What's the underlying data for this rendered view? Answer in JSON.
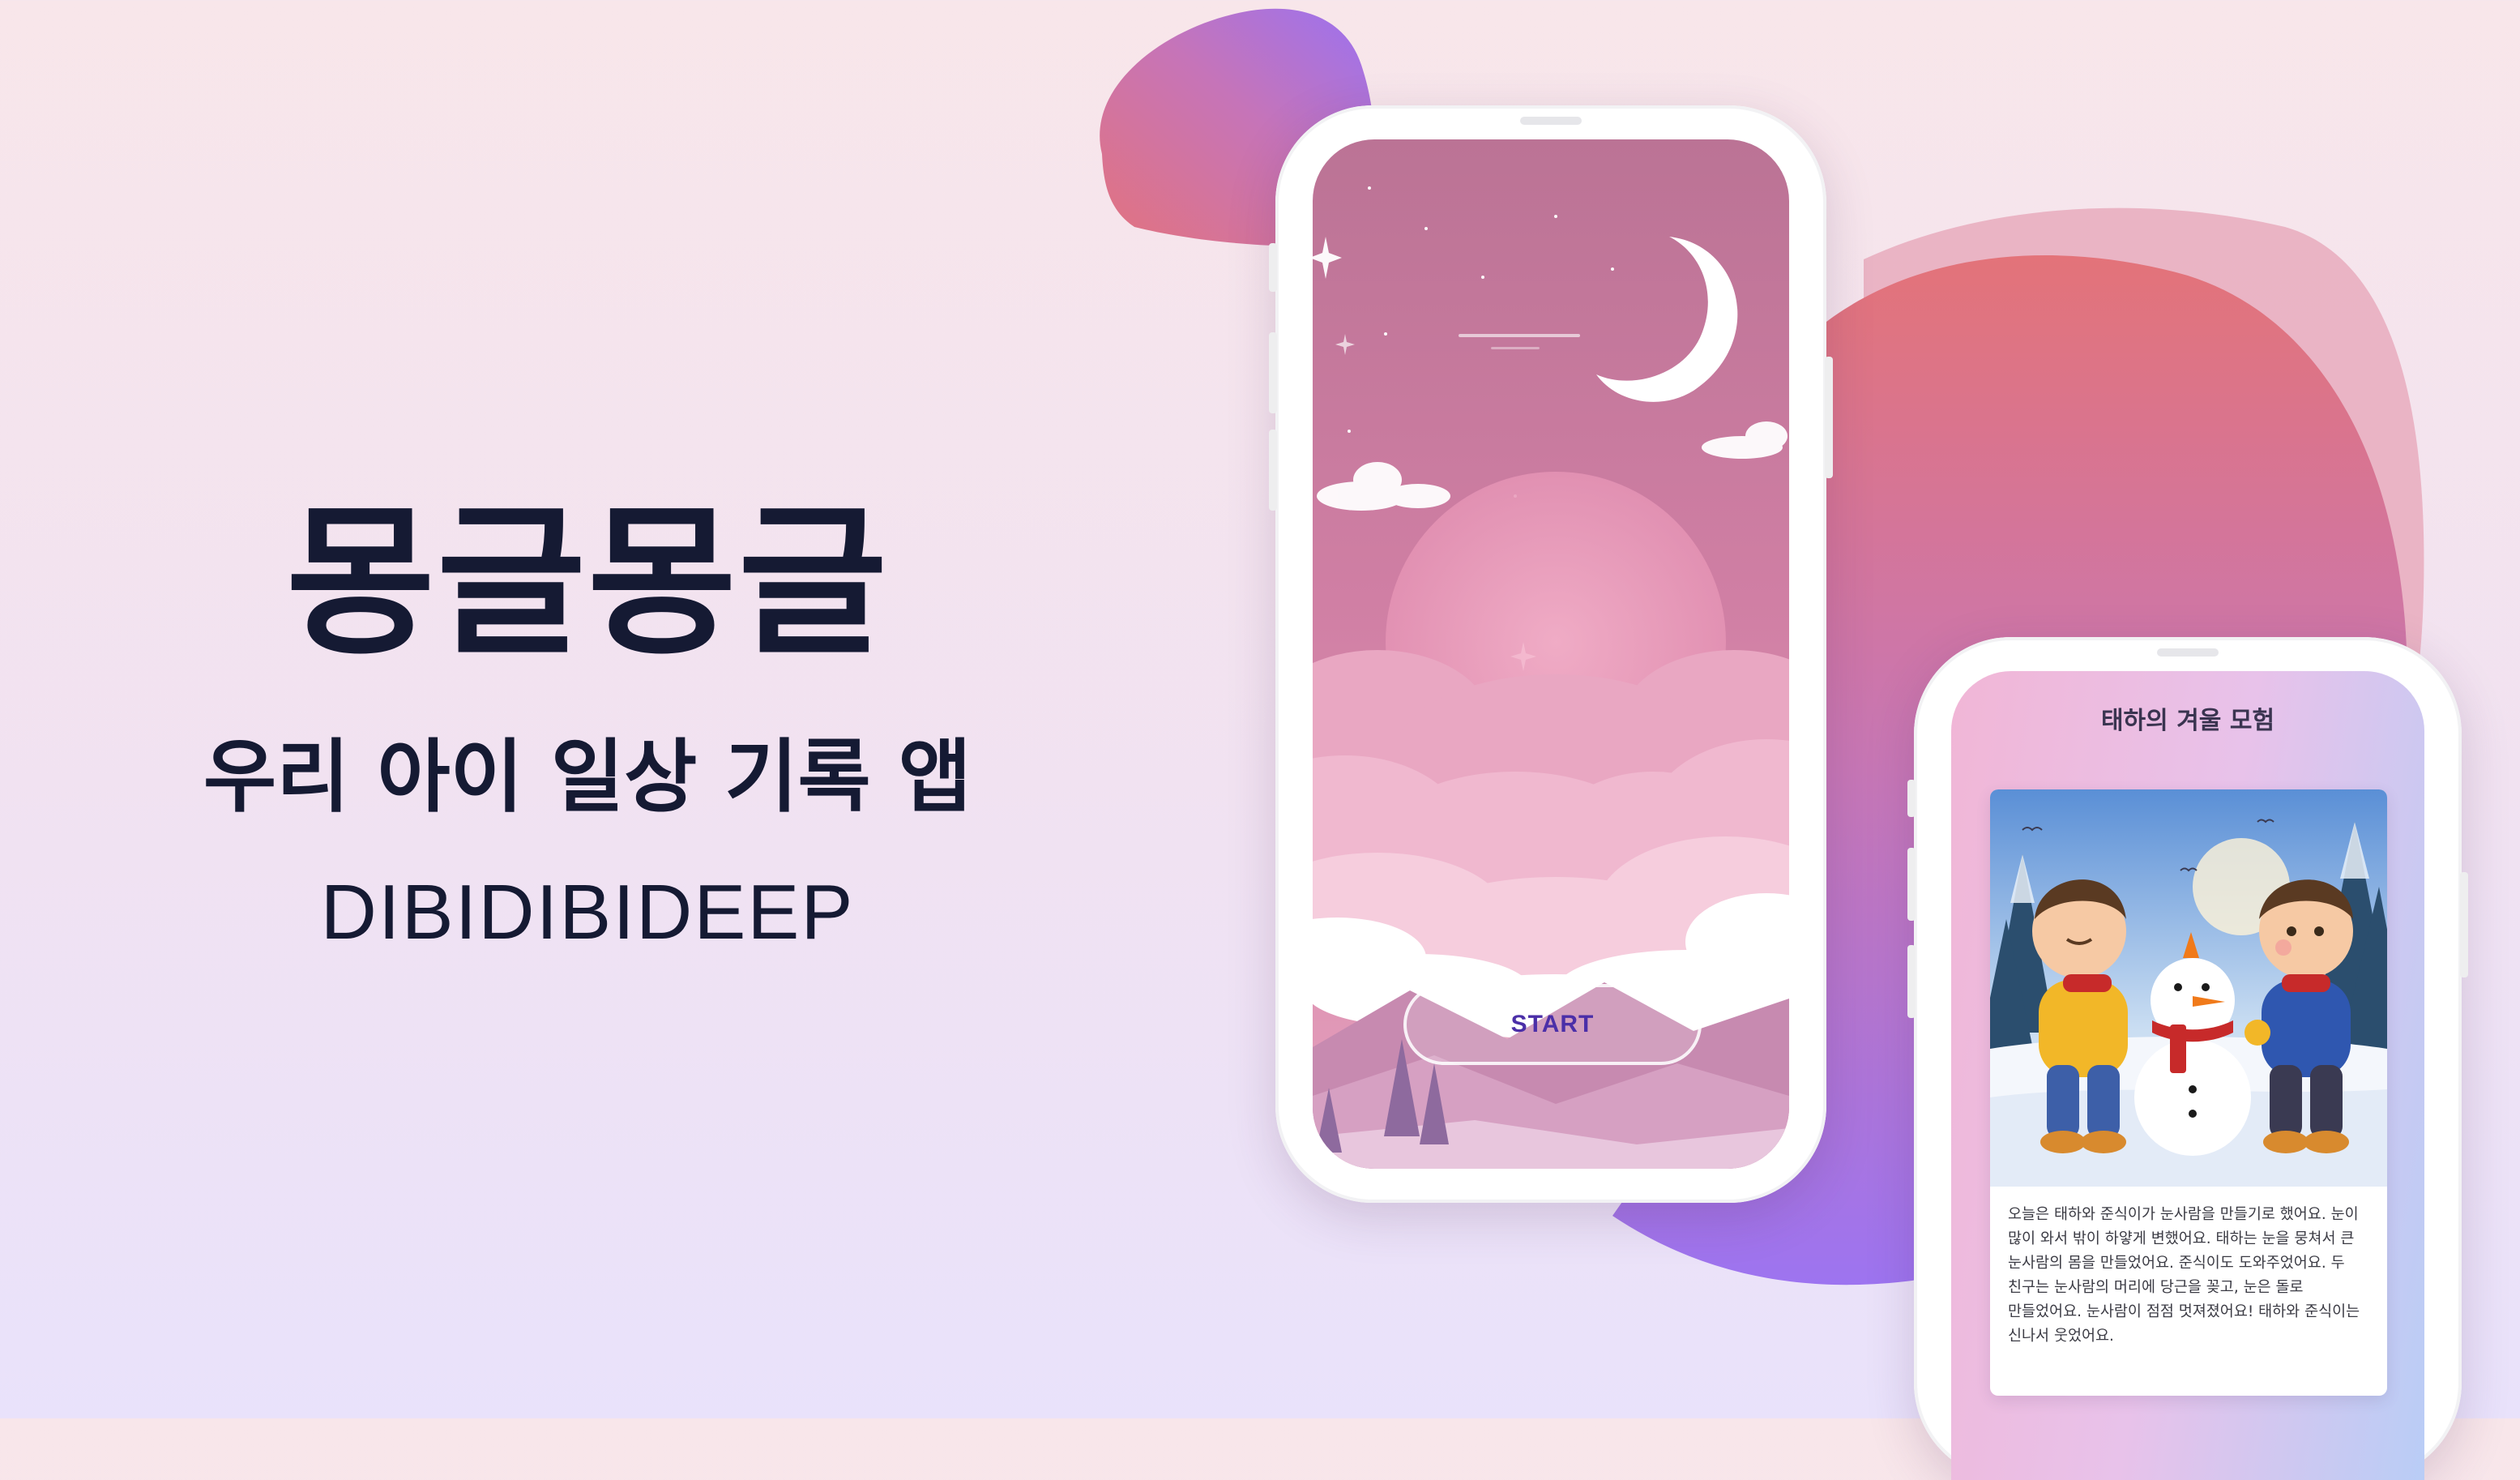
{
  "hero": {
    "title": "몽글몽글",
    "subtitle": "우리 아이 일상 기록 앱",
    "brand": "DIBIDIBIDEEP"
  },
  "splash_screen": {
    "start_label": "START"
  },
  "story_screen": {
    "title": "태하의 겨울 모험",
    "body": "오늘은 태하와 준식이가 눈사람을 만들기로 했어요. 눈이 많이 와서 밖이 하얗게 변했어요. 태하는 눈을 뭉쳐서 큰 눈사람의 몸을 만들었어요. 준식이도 도와주었어요. 두 친구는 눈사람의 머리에 당근을 꽂고, 눈은 돌로 만들었어요. 눈사람이 점점 멋져졌어요! 태하와 준식이는 신나서 웃었어요."
  },
  "colors": {
    "background_top": "#f8e6ea",
    "background_bottom": "#e9e2fb",
    "blob_coral": "#e3737d",
    "blob_purple": "#9b73f0",
    "splash_pink": "#c7799f",
    "start_text": "#4b2fa8",
    "heading_text": "#151a33"
  },
  "icons": {
    "moon": "moon-icon",
    "stars": "star-icon"
  }
}
